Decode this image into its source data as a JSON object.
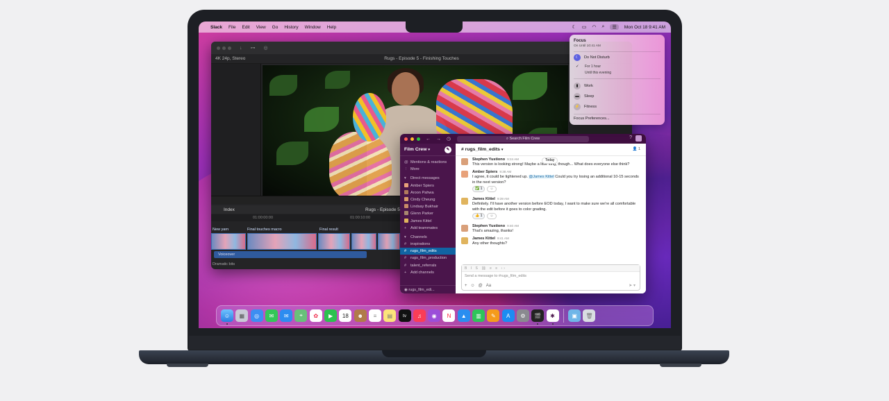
{
  "menubar": {
    "app_name": "Slack",
    "items": [
      "File",
      "Edit",
      "View",
      "Go",
      "History",
      "Window",
      "Help"
    ],
    "datetime": "Mon Oct 18  9:41 AM"
  },
  "fcp": {
    "format": "4K 24p, Stereo",
    "title": "Rugs - Episode 5 - Finishing Touches",
    "index_label": "Index",
    "project_short": "Rugs - Episode 5",
    "ruler": [
      "01:00:00:00",
      "01:00:10:00"
    ],
    "clip_labels": [
      "New yarn",
      "Final touches macro",
      "Final result"
    ],
    "track_label": "Voiceover",
    "bottom_label": "Dramatic bits"
  },
  "slack": {
    "search_placeholder": "Search Film Crew",
    "workspace": "Film Crew",
    "sidebar_top": [
      "Mentions & reactions",
      "More"
    ],
    "dm_header": "Direct messages",
    "dms": [
      "Amber Spiers",
      "Aroon Pahwa",
      "Cindy Cheung",
      "Lindsay Bukhair",
      "Glenn Parker",
      "James Kittel"
    ],
    "add_teammates": "Add teammates",
    "channels_header": "Channels",
    "channels": [
      "inspirations",
      "rugs_film_edits",
      "rugs_film_production",
      "talent_referrals"
    ],
    "add_channels": "Add channels",
    "footer": "rugs_film_edi...",
    "channel_title": "# rugs_film_edits",
    "member_count": "1",
    "today_label": "Today",
    "messages": [
      {
        "name": "Stephen Yustiono",
        "time": "9:24 AM",
        "text": "This version is looking strong! Maybe a little long, though... What does everyone else think?"
      },
      {
        "name": "Amber Spiers",
        "time": "9:38 AM",
        "text_before": "I agree, it could be tightened up. ",
        "mention": "@James Kittel",
        "text_after": " Could you try losing an additional 10-15 seconds in the next version?",
        "reaction": "1"
      },
      {
        "name": "James Kittel",
        "time": "9:39 AM",
        "text": "Definitely. I'll have another version before EOD today, I want to make sure we're all comfortable with the edit before it goes to color grading.",
        "reaction": "1"
      },
      {
        "name": "Stephen Yustiono",
        "time": "9:40 AM",
        "text": "That's amazing, thanks!"
      },
      {
        "name": "James Kittel",
        "time": "9:41 AM",
        "text": "Any other thoughts?"
      }
    ],
    "composer_placeholder": "Send a message to #rugs_film_edits"
  },
  "focus": {
    "title": "Focus",
    "subtitle": "On Until 10:41 AM",
    "dnd": "Do Not Disturb",
    "for_1h": "For 1 hour",
    "until_evening": "Until this evening",
    "work": "Work",
    "sleep": "Sleep",
    "fitness": "Fitness",
    "prefs": "Focus Preferences..."
  },
  "dock": {
    "calendar_day": "18",
    "tv_label": "tv"
  },
  "colors": {
    "slack_sidebar": "#4a154b",
    "slack_active": "#1164a3",
    "focus_accent": "#5b5fe0"
  }
}
